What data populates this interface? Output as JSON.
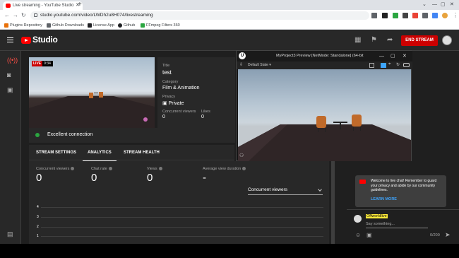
{
  "browser": {
    "tab_title": "Live streaming - YouTube Studio",
    "url": "studio.youtube.com/video/LWDh2u8H074/livestreaming",
    "bookmarks": [
      "Plugins Repository",
      "Github Downloads",
      "License App",
      "Github",
      "FFmpeg Filters 360"
    ]
  },
  "header": {
    "app_name": "Studio",
    "end_stream_label": "END STREAM"
  },
  "preview": {
    "live_label": "LIVE",
    "duration": "0:34"
  },
  "stream_info": {
    "title_label": "Title",
    "title": "test",
    "category_label": "Category",
    "category": "Film & Animation",
    "privacy_label": "Privacy",
    "privacy": "Private",
    "concurrent_label": "Concurrent viewers",
    "concurrent_value": "0",
    "likes_label": "Likes",
    "likes_value": "0"
  },
  "connection": {
    "status": "Excellent connection"
  },
  "tabs": [
    "STREAM SETTINGS",
    "ANALYTICS",
    "STREAM HEALTH"
  ],
  "analytics": {
    "metrics": [
      {
        "label": "Concurrent viewers",
        "value": "0"
      },
      {
        "label": "Chat rate",
        "value": "0"
      },
      {
        "label": "Views",
        "value": "0"
      },
      {
        "label": "Average view duration",
        "value": "-"
      }
    ],
    "dropdown": "Concurrent viewers",
    "y_ticks": [
      "4",
      "3",
      "2",
      "1"
    ]
  },
  "chat": {
    "welcome": "Welcome to live chat! Remember to guard your privacy and abide by our community guidelines.",
    "learn_more": "LEARN MORE",
    "username": "Offworldlive",
    "placeholder": "Say something...",
    "counter": "0/200"
  },
  "ue_window": {
    "title": "MyProject3 Preview [NetMode: Standalone]  (64-bit",
    "view_mode": "Default State"
  },
  "colors": {
    "accent_red": "#cc0000",
    "link_blue": "#3ea6ff",
    "status_green": "#2ba640"
  }
}
